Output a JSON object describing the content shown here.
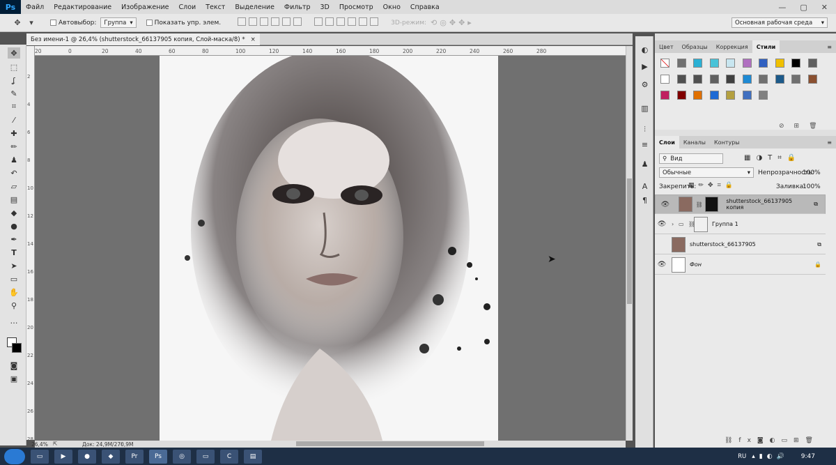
{
  "app": {
    "logo": "Ps"
  },
  "menu": [
    "Файл",
    "Редактирование",
    "Изображение",
    "Слои",
    "Текст",
    "Выделение",
    "Фильтр",
    "3D",
    "Просмотр",
    "Окно",
    "Справка"
  ],
  "window_controls": {
    "minimize": "—",
    "restore": "▢",
    "close": "✕"
  },
  "options": {
    "autoselect_label": "Автовыбор:",
    "autoselect_value": "Группа",
    "show_controls": "Показать упр. элем.",
    "mode_3d": "3D-режим:",
    "workspace": "Основная рабочая среда"
  },
  "document": {
    "tab_title": "Без имени-1 @ 26,4% (shutterstock_66137905 копия, Слой-маска/8) *",
    "zoom": "26,4%",
    "doc_size": "Док: 24,9M/270,9M"
  },
  "ruler_h": [
    "20",
    "0",
    "20",
    "40",
    "60",
    "80",
    "100",
    "120",
    "140",
    "160",
    "180",
    "200",
    "220",
    "240",
    "260",
    "280"
  ],
  "ruler_v": [
    "2",
    "4",
    "6",
    "8",
    "10",
    "12",
    "14",
    "16",
    "18",
    "20",
    "22",
    "24",
    "26",
    "28"
  ],
  "panels": {
    "top_tabs": [
      "Цвет",
      "Образцы",
      "Коррекция",
      "Стили"
    ],
    "top_active": "Стили",
    "layer_tabs": [
      "Слои",
      "Каналы",
      "Контуры"
    ],
    "layer_active": "Слои",
    "kind_filter": "Вид",
    "blend_mode": "Обычные",
    "opacity_label": "Непрозрачность:",
    "opacity": "100%",
    "lock_label": "Закрепить:",
    "fill_label": "Заливка:",
    "fill": "100%"
  },
  "layers": [
    {
      "name": "shutterstock_66137905 копия",
      "selected": true
    },
    {
      "name": "Группа 1",
      "selected": false
    },
    {
      "name": "shutterstock_66137905",
      "selected": false
    },
    {
      "name": "Фон",
      "selected": false
    }
  ],
  "styles_colors": [
    "#ffffff",
    "#707070",
    "#2bb0d4",
    "#49c3d8",
    "#c8e6f0",
    "#b070c0",
    "#3060c0",
    "#f0c000",
    "#000000",
    "#606060",
    "#ffffff",
    "#505050",
    "#505050",
    "#606060",
    "#404040",
    "#1e8ad4",
    "#707070",
    "#1c5a8a",
    "#707070",
    "#8a5030",
    "#c02060",
    "#800000",
    "#e07000",
    "#1e6ad4",
    "#b4a040",
    "#4070c0",
    "#808080"
  ],
  "taskbar": {
    "lang": "RU",
    "time": "9:47"
  }
}
